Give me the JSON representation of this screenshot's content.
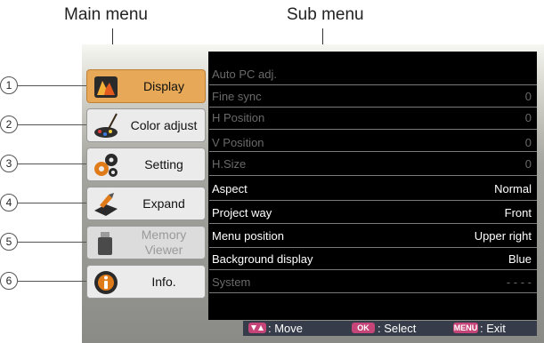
{
  "labels": {
    "main_menu": "Main menu",
    "sub_menu": "Sub menu"
  },
  "main_menu": {
    "items": [
      {
        "number": "1",
        "label": "Display",
        "icon": "display-icon"
      },
      {
        "number": "2",
        "label": "Color adjust",
        "icon": "color-adjust-icon"
      },
      {
        "number": "3",
        "label": "Setting",
        "icon": "setting-icon"
      },
      {
        "number": "4",
        "label": "Expand",
        "icon": "expand-icon"
      },
      {
        "number": "5",
        "label_line1": "Memory",
        "label_line2": "Viewer",
        "icon": "memory-viewer-icon"
      },
      {
        "number": "6",
        "label": "Info.",
        "icon": "info-icon"
      }
    ]
  },
  "sub_menu": {
    "rows": [
      {
        "label": "Auto PC adj.",
        "value": ""
      },
      {
        "label": "Fine sync",
        "value": "0"
      },
      {
        "label": "H Position",
        "value": "0"
      },
      {
        "label": "V Position",
        "value": "0"
      },
      {
        "label": "H.Size",
        "value": "0"
      },
      {
        "label": "Aspect",
        "value": "Normal"
      },
      {
        "label": "Project way",
        "value": "Front"
      },
      {
        "label": "Menu position",
        "value": "Upper right"
      },
      {
        "label": "Background display",
        "value": "Blue"
      },
      {
        "label": "System",
        "value": "- - - -"
      }
    ]
  },
  "status_bar": {
    "move_label": ": Move",
    "ok_key": "OK",
    "select_label": ": Select",
    "menu_key": "MENU",
    "exit_label": ": Exit"
  },
  "colors": {
    "active_item": "#e7a957",
    "key_badge": "#c64578",
    "submenu_bg": "#000000"
  }
}
